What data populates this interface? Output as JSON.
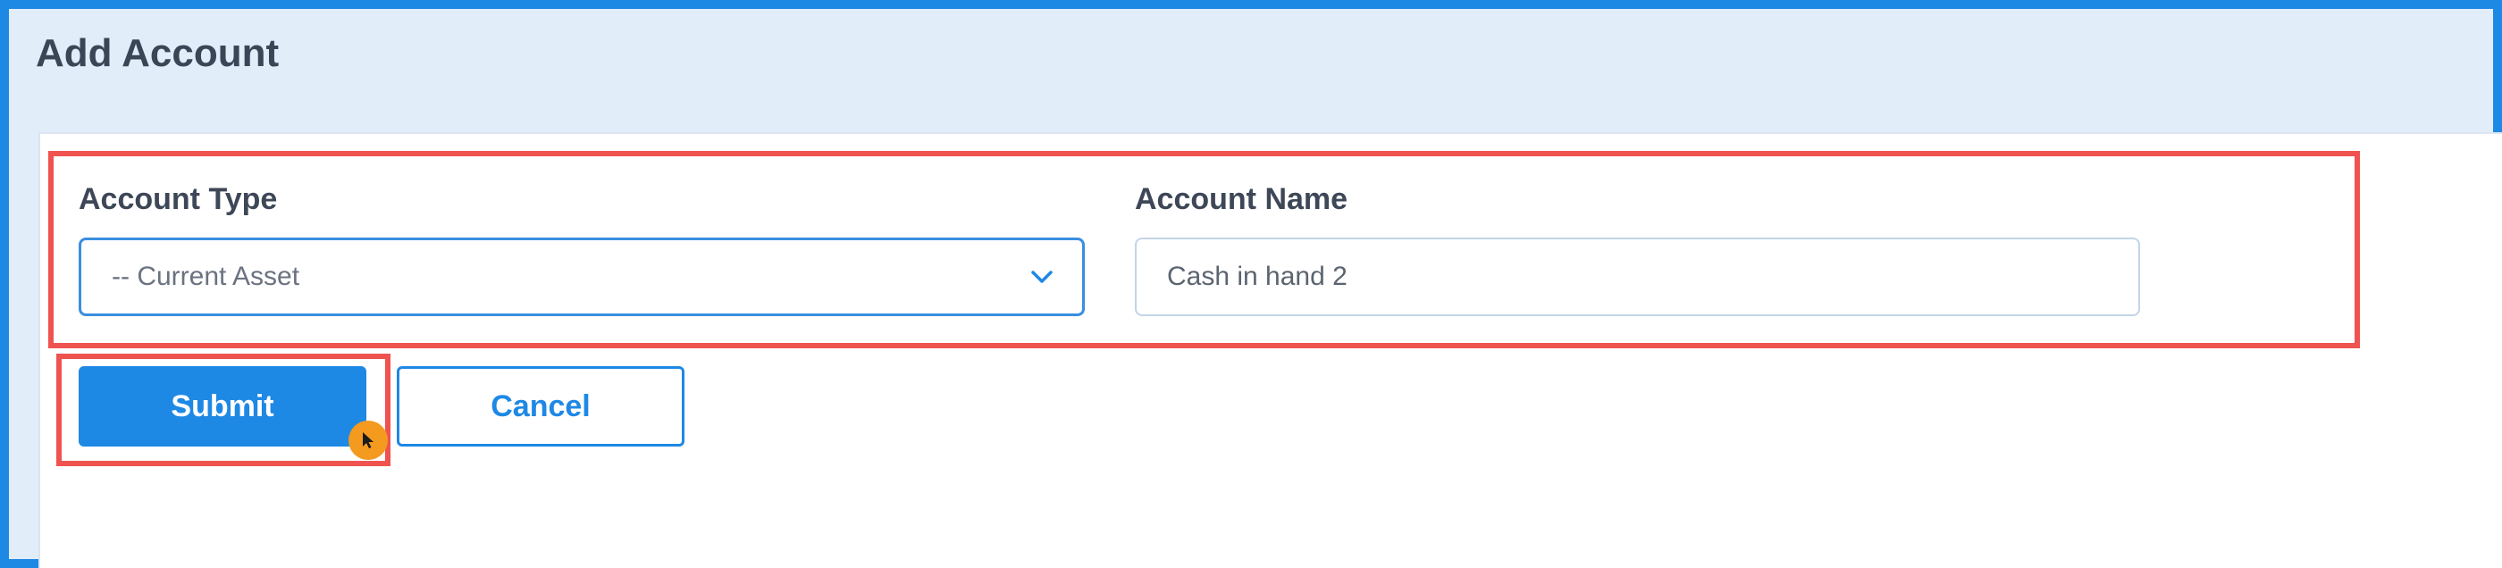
{
  "page": {
    "title": "Add Account"
  },
  "form": {
    "account_type": {
      "label": "Account Type",
      "selected": "-- Current Asset"
    },
    "account_name": {
      "label": "Account Name",
      "value": "Cash in hand 2"
    }
  },
  "actions": {
    "submit_label": "Submit",
    "cancel_label": "Cancel"
  },
  "colors": {
    "frame_border": "#1E88E5",
    "header_bg": "#E2EDFA",
    "primary": "#1E88E5",
    "highlight": "#EF5350",
    "cursor": "#F39A1F"
  },
  "icons": {
    "select_chevron": "chevron-down-icon",
    "pointer": "mouse-pointer-icon"
  }
}
